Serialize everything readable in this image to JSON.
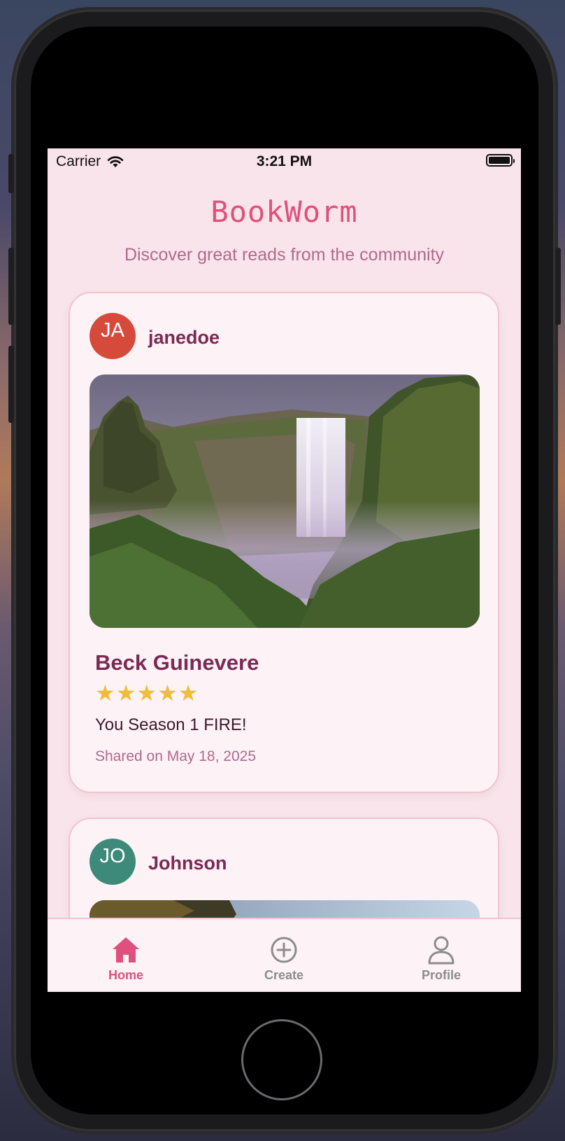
{
  "status_bar": {
    "carrier": "Carrier",
    "time": "3:21 PM"
  },
  "header": {
    "title": "BookWorm",
    "subtitle": "Discover great reads from the community"
  },
  "feed": [
    {
      "avatar_initials": "JA",
      "avatar_color": "#d64a3c",
      "username": "janedoe",
      "book_title": "Beck Guinevere",
      "rating_stars": "★★★★★",
      "rating": 5,
      "review": "You Season 1 FIRE!",
      "shared": "Shared on May 18, 2025"
    },
    {
      "avatar_initials": "JO",
      "avatar_color": "#3d8a7a",
      "username": "Johnson"
    }
  ],
  "tab_bar": {
    "home": "Home",
    "create": "Create",
    "profile": "Profile",
    "active_color": "#e0507e",
    "inactive_color": "#8c8c8c"
  }
}
